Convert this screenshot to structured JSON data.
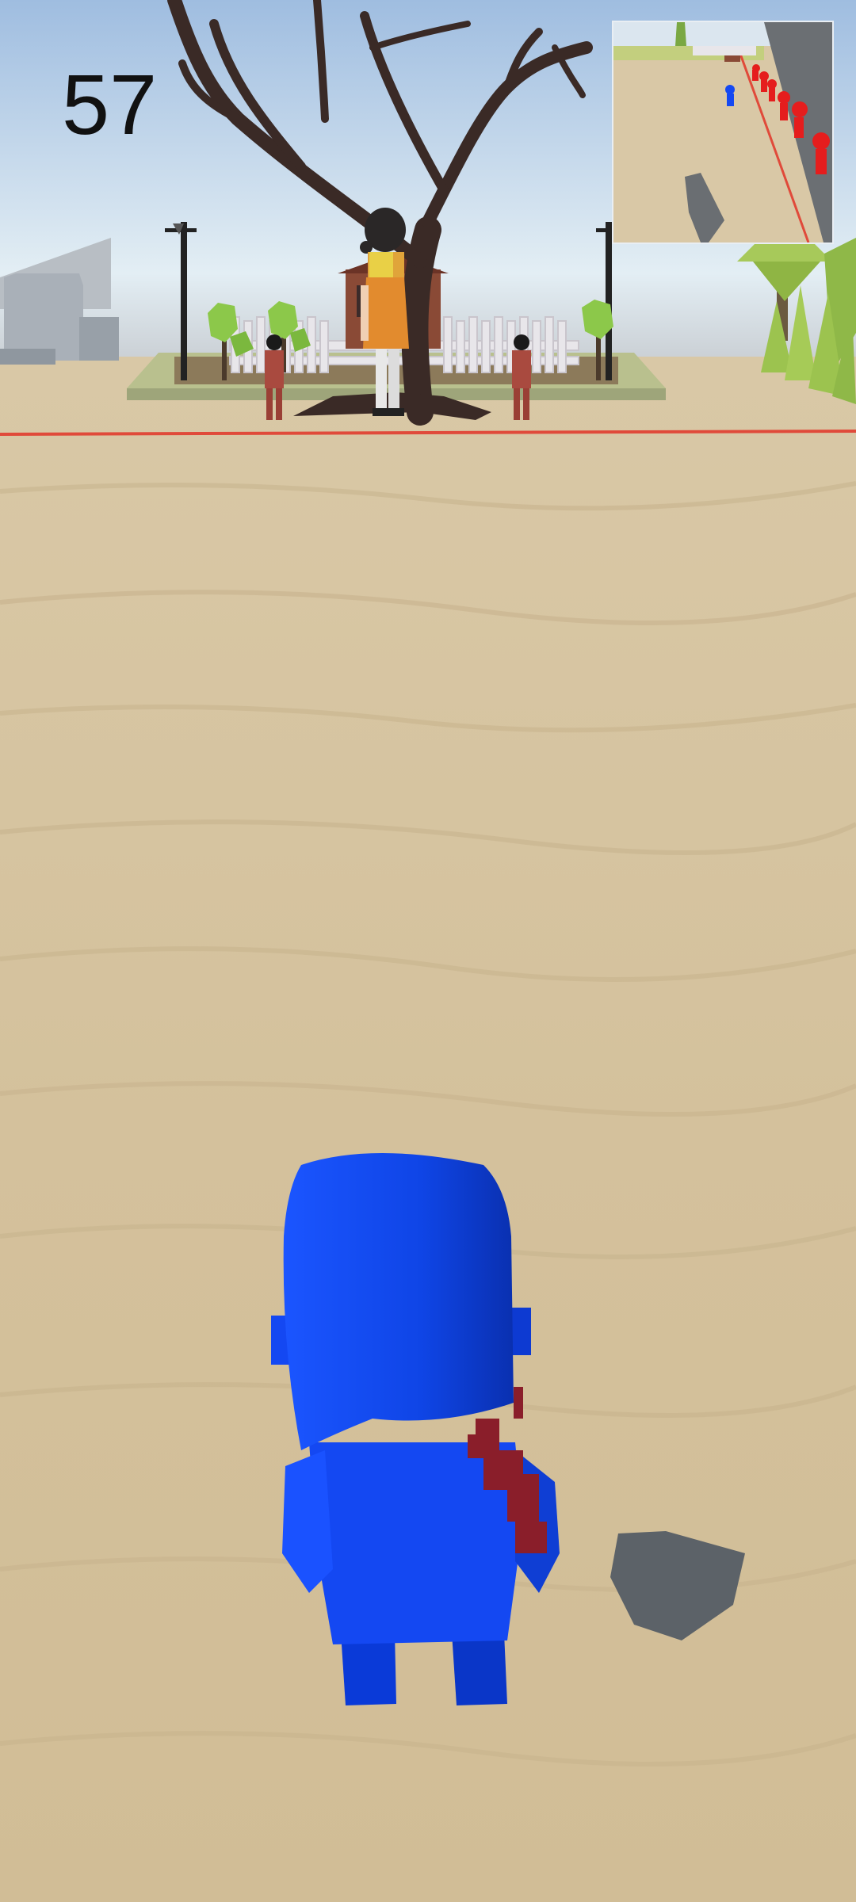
{
  "hud": {
    "timer": "57"
  },
  "colors": {
    "sky_top": "#9fbde0",
    "sky_horizon": "#e7f1f6",
    "ground": "#d6c3a0",
    "finish_line": "#e04a3a",
    "player": "#1245e8",
    "guards": "#a94a3f",
    "opponents": "#e51d1d"
  },
  "icons": {
    "minimap": "minimap-view",
    "player": "player-character",
    "doll": "giant-doll",
    "tree": "dead-tree"
  }
}
